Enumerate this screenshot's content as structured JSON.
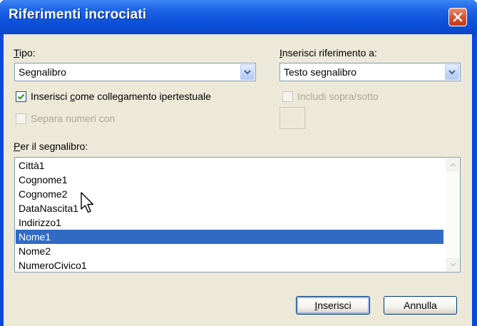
{
  "dialog": {
    "title": "Riferimenti incrociati"
  },
  "tipo": {
    "label_u": "T",
    "label_rest": "ipo:",
    "value": "Segnalibro"
  },
  "inserisci_riferimento": {
    "label_pre": "",
    "label_u": "I",
    "label_rest": "nserisci riferimento a:",
    "value": "Testo segnalibro"
  },
  "hyperlink_checkbox": {
    "label_pre": "Inserisci ",
    "label_u": "c",
    "label_rest": "ome collegamento ipertestuale",
    "checked": true
  },
  "separa_checkbox": {
    "label": "Separa numeri con",
    "checked": false,
    "enabled": false
  },
  "includi_checkbox": {
    "label": "Includi sopra/sotto",
    "checked": false,
    "enabled": false
  },
  "per_segnalibro": {
    "label_u": "P",
    "label_rest": "er il segnalibro:"
  },
  "bookmarks": [
    "Città1",
    "Cognome1",
    "Cognome2",
    "DataNascita1",
    "Indirizzo1",
    "Nome1",
    "Nome2",
    "NumeroCivico1"
  ],
  "selected_bookmark": "Nome1",
  "buttons": {
    "insert_u": "I",
    "insert_rest": "nserisci",
    "cancel": "Annulla"
  },
  "icons": {
    "close": "close-icon",
    "dropdown": "chevron-down-icon",
    "check": "checkmark-icon",
    "scroll_up": "scroll-up-icon",
    "scroll_down": "scroll-down-icon",
    "cursor": "mouse-pointer-icon"
  },
  "colors": {
    "title_bar": "#0a4ad6",
    "dialog_face": "#ece9d8",
    "selection": "#316ac5",
    "close_button": "#d9532f"
  }
}
